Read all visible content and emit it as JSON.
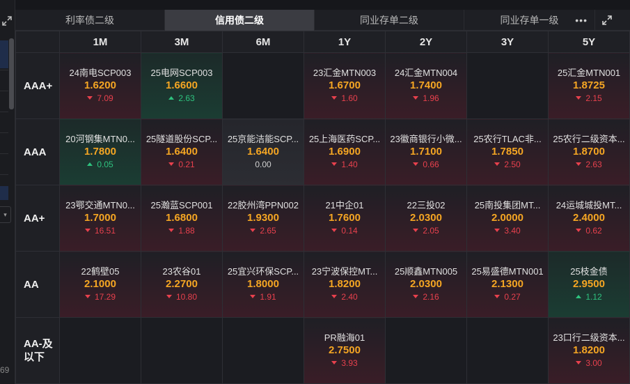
{
  "tabs": [
    {
      "label": "利率债二级",
      "active": false
    },
    {
      "label": "信用债二级",
      "active": true
    },
    {
      "label": "同业存单二级",
      "active": false
    },
    {
      "label": "同业存单一级",
      "active": false
    }
  ],
  "side_panel": {
    "partial_number": "69"
  },
  "tenors": [
    "1M",
    "3M",
    "6M",
    "1Y",
    "2Y",
    "3Y",
    "5Y"
  ],
  "colors": {
    "rate": "#f5a623",
    "down": "#e8414d",
    "up": "#2ec27e",
    "active_tab": "#3b3c42"
  },
  "rows": [
    {
      "rating": "AAA+",
      "cells": [
        {
          "name": "24南电SCP003",
          "rate": "1.6200",
          "change": "7.09",
          "dir": "down"
        },
        {
          "name": "25电网SCP003",
          "rate": "1.6600",
          "change": "2.63",
          "dir": "up"
        },
        null,
        {
          "name": "23汇金MTN003",
          "rate": "1.6700",
          "change": "1.60",
          "dir": "down"
        },
        {
          "name": "24汇金MTN004",
          "rate": "1.7400",
          "change": "1.96",
          "dir": "down"
        },
        null,
        {
          "name": "25汇金MTN001",
          "rate": "1.8725",
          "change": "2.15",
          "dir": "down"
        }
      ]
    },
    {
      "rating": "AAA",
      "cells": [
        {
          "name": "20河钢集MTN0...",
          "rate": "1.7800",
          "change": "0.05",
          "dir": "up"
        },
        {
          "name": "25隧道股份SCP...",
          "rate": "1.6400",
          "change": "0.21",
          "dir": "down"
        },
        {
          "name": "25京能洁能SCP...",
          "rate": "1.6400",
          "change": "0.00",
          "dir": "flat"
        },
        {
          "name": "25上海医药SCP...",
          "rate": "1.6900",
          "change": "1.40",
          "dir": "down"
        },
        {
          "name": "23徽商银行小微...",
          "rate": "1.7100",
          "change": "0.66",
          "dir": "down"
        },
        {
          "name": "25农行TLAC非...",
          "rate": "1.7850",
          "change": "2.50",
          "dir": "down"
        },
        {
          "name": "25农行二级资本...",
          "rate": "1.8700",
          "change": "2.63",
          "dir": "down"
        }
      ]
    },
    {
      "rating": "AA+",
      "cells": [
        {
          "name": "23鄂交通MTN0...",
          "rate": "1.7000",
          "change": "16.51",
          "dir": "down"
        },
        {
          "name": "25瀚蓝SCP001",
          "rate": "1.6800",
          "change": "1.88",
          "dir": "down"
        },
        {
          "name": "22胶州湾PPN002",
          "rate": "1.9300",
          "change": "2.65",
          "dir": "down"
        },
        {
          "name": "21中企01",
          "rate": "1.7600",
          "change": "0.14",
          "dir": "down"
        },
        {
          "name": "22三投02",
          "rate": "2.0300",
          "change": "2.05",
          "dir": "down"
        },
        {
          "name": "25南投集团MT...",
          "rate": "2.0000",
          "change": "3.40",
          "dir": "down"
        },
        {
          "name": "24运城城投MT...",
          "rate": "2.4000",
          "change": "0.62",
          "dir": "down"
        }
      ]
    },
    {
      "rating": "AA",
      "cells": [
        {
          "name": "22鹤壁05",
          "rate": "2.1000",
          "change": "17.29",
          "dir": "down"
        },
        {
          "name": "23农谷01",
          "rate": "2.2700",
          "change": "10.80",
          "dir": "down"
        },
        {
          "name": "25宜兴环保SCP...",
          "rate": "1.8000",
          "change": "1.91",
          "dir": "down"
        },
        {
          "name": "23宁波保控MT...",
          "rate": "1.8200",
          "change": "2.40",
          "dir": "down"
        },
        {
          "name": "25顺鑫MTN005",
          "rate": "2.0300",
          "change": "2.16",
          "dir": "down"
        },
        {
          "name": "25易盛德MTN001",
          "rate": "2.1300",
          "change": "0.27",
          "dir": "down"
        },
        {
          "name": "25枝金债",
          "rate": "2.9500",
          "change": "1.12",
          "dir": "up"
        }
      ]
    },
    {
      "rating": "AA-及以下",
      "cells": [
        null,
        null,
        null,
        {
          "name": "PR融海01",
          "rate": "2.7500",
          "change": "3.93",
          "dir": "down"
        },
        null,
        null,
        {
          "name": "23口行二级资本...",
          "rate": "1.8200",
          "change": "3.00",
          "dir": "down"
        }
      ]
    }
  ]
}
